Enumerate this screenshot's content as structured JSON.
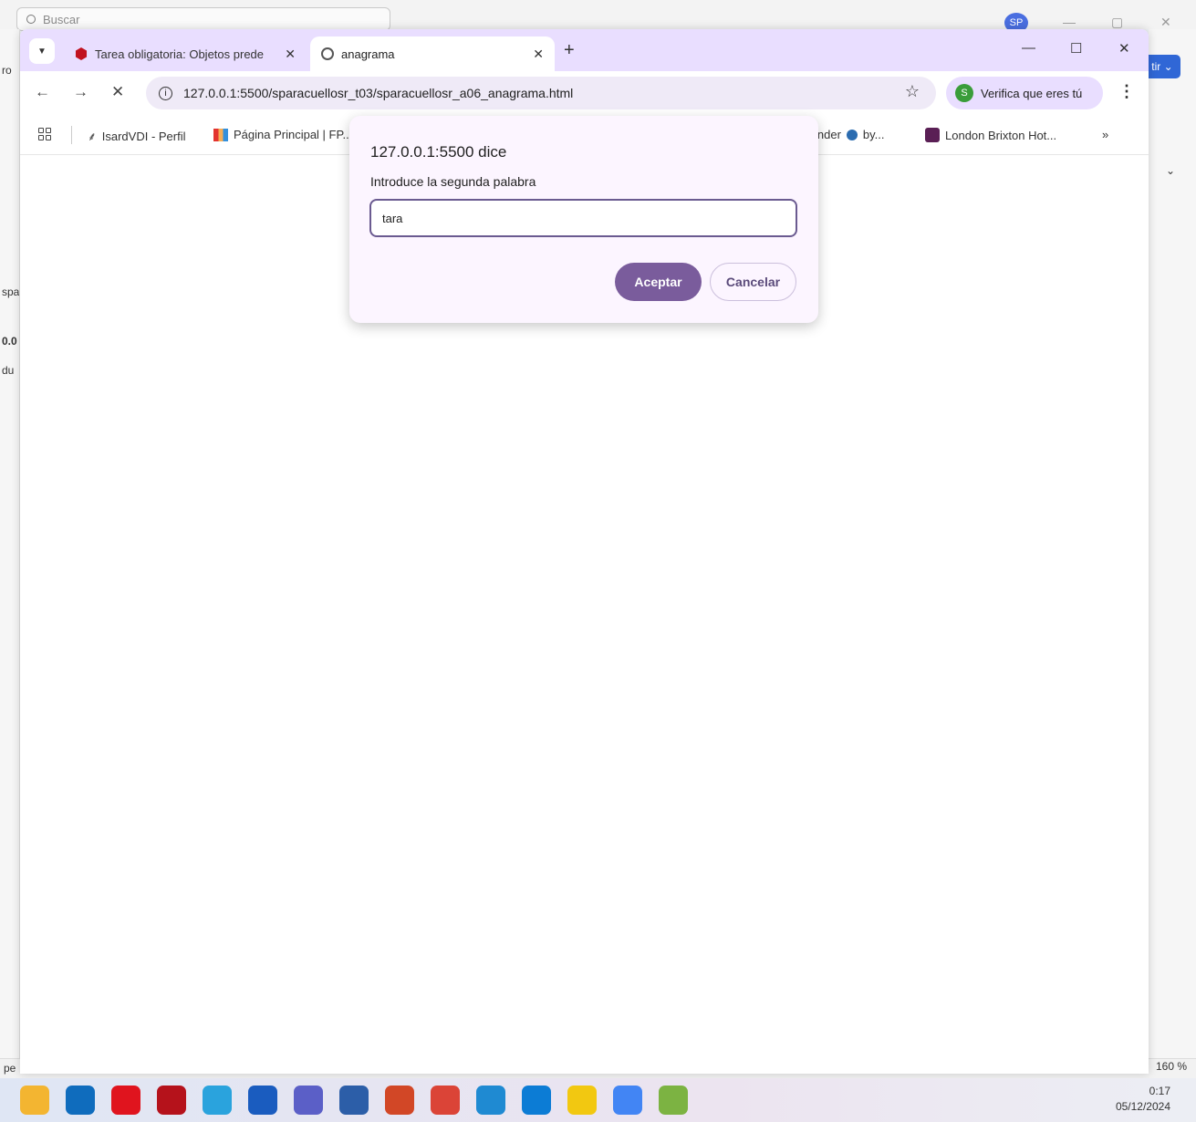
{
  "background_window": {
    "search_placeholder": "Buscar",
    "avatar_initials": "SP",
    "share_label": "tir",
    "left_fragments": [
      "ro",
      "spa",
      "0.0",
      "du"
    ],
    "bottom_left_fragment": "pe",
    "zoom_level": "160 %"
  },
  "browser": {
    "tabs": [
      {
        "title": "Tarea obligatoria: Objetos prede",
        "active": false
      },
      {
        "title": "anagrama",
        "active": true
      }
    ],
    "url": "127.0.0.1:5500/sparacuellosr_t03/sparacuellosr_a06_anagrama.html",
    "verify_label": "Verifica que eres tú",
    "profile_initial": "S",
    "bookmarks": [
      {
        "label": "IsardVDI - Perfil"
      },
      {
        "label": "Página Principal | FP..."
      },
      {
        "label": "inder"
      },
      {
        "label": "by..."
      },
      {
        "label": "London Brixton Hot..."
      }
    ],
    "bookmarks_overflow": "»"
  },
  "dialog": {
    "title": "127.0.0.1:5500 dice",
    "message": "Introduce la segunda palabra",
    "input_value": "tara",
    "accept_label": "Aceptar",
    "cancel_label": "Cancelar"
  },
  "taskbar": {
    "time": "0:17",
    "date": "05/12/2024",
    "apps": [
      {
        "name": "file-explorer",
        "color": "#f3b531"
      },
      {
        "name": "outlook",
        "color": "#0f6cbd"
      },
      {
        "name": "opera",
        "color": "#e0141e"
      },
      {
        "name": "ruby-app",
        "color": "#b5121b"
      },
      {
        "name": "telegram",
        "color": "#2aa3dd"
      },
      {
        "name": "word",
        "color": "#1a5cbf"
      },
      {
        "name": "teams",
        "color": "#5b5fc7"
      },
      {
        "name": "virtualbox",
        "color": "#2c5ea8"
      },
      {
        "name": "powerpoint",
        "color": "#d24726"
      },
      {
        "name": "chrome",
        "color": "#db4437"
      },
      {
        "name": "vscode",
        "color": "#1f8ad2"
      },
      {
        "name": "edge",
        "color": "#0c7cd5"
      },
      {
        "name": "sticky-notes",
        "color": "#f2c811"
      },
      {
        "name": "chrome-profile",
        "color": "#4285f4"
      },
      {
        "name": "paint-app",
        "color": "#7cb342"
      }
    ]
  }
}
